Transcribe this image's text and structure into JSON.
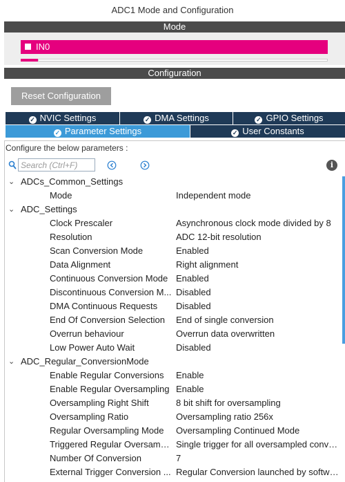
{
  "window": {
    "title": "ADC1 Mode and Configuration"
  },
  "mode": {
    "header": "Mode",
    "channel": {
      "label": "IN0",
      "color": "#e5007e"
    }
  },
  "configuration": {
    "header": "Configuration",
    "reset_label": "Reset Configuration",
    "tabs_row1": [
      {
        "label": "NVIC Settings"
      },
      {
        "label": "DMA Settings"
      },
      {
        "label": "GPIO Settings"
      }
    ],
    "tabs_row2": [
      {
        "label": "Parameter Settings",
        "active": true
      },
      {
        "label": "User Constants",
        "active": false
      }
    ],
    "instructions": "Configure the below parameters :",
    "search": {
      "placeholder": "Search (Ctrl+F)"
    },
    "colors": {
      "tab_dark": "#1f3a57",
      "tab_active": "#3c9ad8",
      "header_bar": "#4b4b4b"
    }
  },
  "tree": [
    {
      "type": "group",
      "label": "ADCs_Common_Settings"
    },
    {
      "type": "param",
      "name": "Mode",
      "value": "Independent mode"
    },
    {
      "type": "group",
      "label": "ADC_Settings"
    },
    {
      "type": "param",
      "name": "Clock Prescaler",
      "value": "Asynchronous clock mode divided by 8"
    },
    {
      "type": "param",
      "name": "Resolution",
      "value": "ADC 12-bit resolution"
    },
    {
      "type": "param",
      "name": "Scan Conversion Mode",
      "value": "Enabled"
    },
    {
      "type": "param",
      "name": "Data Alignment",
      "value": "Right alignment"
    },
    {
      "type": "param",
      "name": "Continuous Conversion Mode",
      "value": "Enabled"
    },
    {
      "type": "param",
      "name": "Discontinuous Conversion M...",
      "value": "Disabled"
    },
    {
      "type": "param",
      "name": "DMA Continuous Requests",
      "value": "Disabled"
    },
    {
      "type": "param",
      "name": "End Of Conversion Selection",
      "value": "End of single conversion"
    },
    {
      "type": "param",
      "name": "Overrun behaviour",
      "value": "Overrun data overwritten"
    },
    {
      "type": "param",
      "name": "Low Power Auto Wait",
      "value": "Disabled"
    },
    {
      "type": "group",
      "label": "ADC_Regular_ConversionMode"
    },
    {
      "type": "param",
      "name": "Enable Regular Conversions",
      "value": "Enable"
    },
    {
      "type": "param",
      "name": "Enable Regular Oversampling",
      "value": "Enable"
    },
    {
      "type": "param",
      "name": "Oversampling Right Shift",
      "value": "8 bit shift for oversampling"
    },
    {
      "type": "param",
      "name": "Oversampling Ratio",
      "value": "Oversampling ratio 256x"
    },
    {
      "type": "param",
      "name": "Regular Oversampling Mode",
      "value": "Oversampling Continued Mode"
    },
    {
      "type": "param",
      "name": "Triggered Regular Oversampl...",
      "value": "Single trigger for all oversampled conver..."
    },
    {
      "type": "param",
      "name": "Number Of Conversion",
      "value": "7"
    },
    {
      "type": "param",
      "name": "External Trigger Conversion ...",
      "value": "Regular Conversion launched by softwa..."
    }
  ]
}
